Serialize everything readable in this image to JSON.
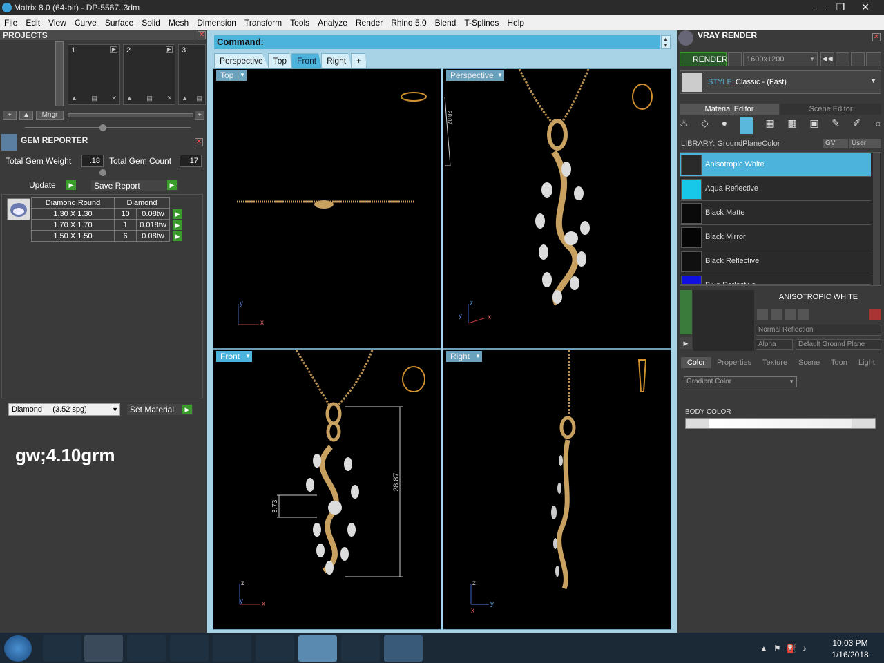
{
  "window": {
    "title": "Matrix 8.0 (64-bit) - DP-5567..3dm"
  },
  "menu": [
    "File",
    "Edit",
    "View",
    "Curve",
    "Surface",
    "Solid",
    "Mesh",
    "Dimension",
    "Transform",
    "Tools",
    "Analyze",
    "Render",
    "Rhino 5.0",
    "Blend",
    "T-Splines",
    "Help"
  ],
  "projects": {
    "title": "PROJECTS",
    "slots": [
      "1",
      "2",
      "3"
    ],
    "mngr_label": "Mngr"
  },
  "gem_reporter": {
    "title": "GEM REPORTER",
    "total_weight_label": "Total Gem Weight",
    "total_weight": ".18",
    "total_count_label": "Total Gem Count",
    "total_count": "17",
    "update_label": "Update",
    "save_report_label": "Save Report",
    "table": {
      "headers": [
        "Diamond Round",
        "Diamond"
      ],
      "rows": [
        {
          "size": "1.30 X 1.30",
          "count": "10",
          "weight": "0.08tw"
        },
        {
          "size": "1.70 X 1.70",
          "count": "1",
          "weight": "0.018tw"
        },
        {
          "size": "1.50 X 1.50",
          "count": "6",
          "weight": "0.08tw"
        }
      ]
    },
    "material_select": "Diamond     (3.52 spg)",
    "set_material_label": "Set Material"
  },
  "note": "gw;4.10grm",
  "command": {
    "label": "Command:"
  },
  "view_tabs": [
    "Perspective",
    "Top",
    "Front",
    "Right",
    "+"
  ],
  "active_view_tab": "Front",
  "viewports": {
    "top": {
      "label": "Top"
    },
    "perspective": {
      "label": "Perspective",
      "dim": "28.87"
    },
    "front": {
      "label": "Front",
      "dim_height": "28.87",
      "dim_width": "3.73"
    },
    "right": {
      "label": "Right"
    }
  },
  "axes": {
    "x": "x",
    "y": "y",
    "z": "z"
  },
  "vray": {
    "title": "VRAY RENDER",
    "render_label": "RENDER",
    "resolution": "1600x1200",
    "style_label": "STYLE:",
    "style_value": "Classic - (Fast)",
    "tabs": [
      "Material Editor",
      "Scene Editor"
    ],
    "library_label": "LIBRARY: GroundPlaneColor",
    "gv_label": "GV",
    "user_label": "User",
    "materials": [
      {
        "name": "Anisotropic White",
        "color": "#2a2a2a",
        "selected": true
      },
      {
        "name": "Aqua Reflective",
        "color": "#18c8e8",
        "selected": false
      },
      {
        "name": "Black Matte",
        "color": "#0a0a0a",
        "selected": false
      },
      {
        "name": "Black Mirror",
        "color": "#050505",
        "selected": false
      },
      {
        "name": "Black Reflective",
        "color": "#101010",
        "selected": false
      },
      {
        "name": "Blue Reflective",
        "color": "#1010e0",
        "selected": false
      }
    ],
    "preview_title": "ANISOTROPIC WHITE",
    "reflection_select": "Normal Reflection",
    "alpha_label": "Alpha",
    "ground_plane_label": "Default Ground Plane",
    "prop_tabs": [
      "Color",
      "Properties",
      "Texture",
      "Scene",
      "Toon",
      "Light"
    ],
    "gradient_select": "Gradient Color",
    "body_color_label": "BODY COLOR"
  },
  "taskbar": {
    "time": "10:03 PM",
    "date": "1/16/2018"
  },
  "colors": {
    "accent": "#4bb3dc",
    "green": "#3a9c2a",
    "gold": "#c8a060"
  }
}
